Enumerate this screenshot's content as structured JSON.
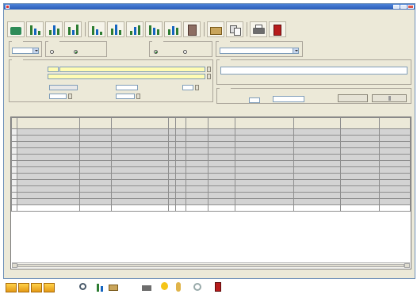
{
  "window": {
    "title": "",
    "menu": [
      "",
      "",
      "",
      "",
      "",
      "",
      "",
      "",
      "",
      "",
      ""
    ]
  },
  "toolbar": {
    "icons": [
      "save-icon",
      "chart-icon",
      "chart-icon",
      "chart-icon",
      "chart-icon",
      "chart-icon",
      "chart-icon",
      "chart-icon",
      "report-icon",
      "folder-icon",
      "copy-icon",
      "print-icon",
      "exit-icon"
    ]
  },
  "filters": {
    "group1_label": "",
    "combo1_value": "",
    "group2_label": "",
    "radio_a": "",
    "radio_b": "",
    "group3_label": "",
    "radio_c": "",
    "radio_d": "",
    "group4_label": "",
    "combo4_value": ""
  },
  "product": {
    "group_label": "",
    "code_label": "",
    "code_prefix": "",
    "code_value": "",
    "desc_label": "",
    "field3_label": "",
    "field3_value": "",
    "field4_label": "",
    "field4_value": "",
    "field5_label": "",
    "field5_value": "",
    "field6_label": "",
    "field6_value": "",
    "field7_label": "",
    "field7_value": "",
    "field8_label": "",
    "field8_value": ""
  },
  "notes": {
    "group_label": "",
    "text": ""
  },
  "summary": {
    "label1": "",
    "label2": "",
    "value2": "",
    "label3": "",
    "value3": "",
    "btn_label": ""
  },
  "grid": {
    "group_label": "",
    "columns": [
      "",
      "",
      "",
      "",
      "",
      "",
      "",
      "",
      "",
      "",
      ""
    ],
    "rows": [
      [
        "",
        "",
        "",
        "",
        "",
        "",
        "",
        "",
        "",
        "",
        ""
      ],
      [
        "",
        "",
        "",
        "",
        "",
        "",
        "",
        "",
        "",
        "",
        ""
      ],
      [
        "",
        "",
        "",
        "",
        "",
        "",
        "",
        "",
        "",
        "",
        ""
      ],
      [
        "",
        "",
        "",
        "",
        "",
        "",
        "",
        "",
        "",
        "",
        ""
      ],
      [
        "",
        "",
        "",
        "",
        "",
        "",
        "",
        "",
        "",
        "",
        ""
      ],
      [
        "",
        "",
        "",
        "",
        "",
        "",
        "",
        "",
        "",
        "",
        ""
      ],
      [
        "",
        "",
        "",
        "",
        "",
        "",
        "",
        "",
        "",
        "",
        ""
      ],
      [
        "",
        "",
        "",
        "",
        "",
        "",
        "",
        "",
        "",
        "",
        ""
      ],
      [
        "",
        "",
        "",
        "",
        "",
        "",
        "",
        "",
        "",
        "",
        ""
      ],
      [
        "",
        "",
        "",
        "",
        "",
        "",
        "",
        "",
        "",
        "",
        ""
      ],
      [
        "",
        "",
        "",
        "",
        "",
        "",
        "",
        "",
        "",
        "",
        ""
      ],
      [
        "",
        "",
        "",
        "",
        "",
        "",
        "",
        "",
        "",
        "",
        ""
      ]
    ]
  },
  "bottom_toolbar": {
    "icons": [
      "first-icon",
      "prev-icon",
      "next-icon",
      "last-icon",
      "search-icon",
      "chart-icon",
      "folder-icon",
      "print-icon",
      "bulb-icon",
      "user-icon",
      "refresh-icon",
      "exit-icon"
    ]
  },
  "colors": {
    "accent": "#2a5bb8",
    "highlight": "#fffcb3",
    "status_green": "#1a7a1a"
  }
}
